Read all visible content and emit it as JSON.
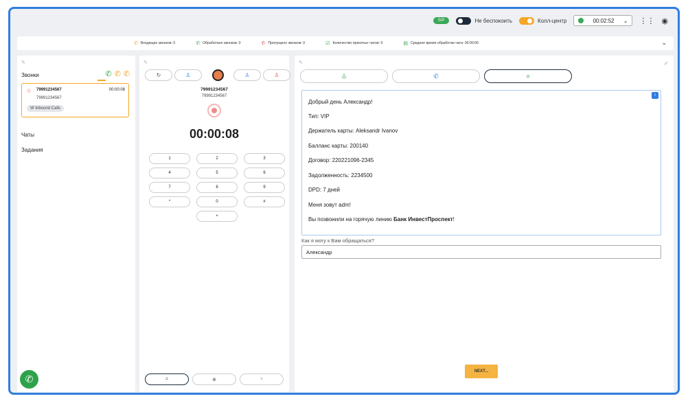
{
  "topbar": {
    "sip": "SIP",
    "dnd_label": "Не беспокоить",
    "callcenter_label": "Колл-центр",
    "timer": "00:02:52"
  },
  "stats": [
    {
      "icon": "incoming-call-icon",
      "label": "Входящих звонков: 0"
    },
    {
      "icon": "processed-call-icon",
      "label": "Обработано звонков: 0"
    },
    {
      "icon": "missed-call-icon",
      "label": "Пропущено звонков: 0"
    },
    {
      "icon": "chat-accepted-icon",
      "label": "Количество принятых чатов: 0"
    },
    {
      "icon": "chat-time-icon",
      "label": "Среднее время обработки чата: 00:00:00"
    }
  ],
  "left": {
    "section_title": "Звонки",
    "call": {
      "number": "79991234567",
      "time": "00:00:08",
      "number2": "79991234567",
      "tag": "W Inbound Calls"
    },
    "nav": [
      "Чаты",
      "Задания"
    ]
  },
  "dialer": {
    "number1": "79991234567",
    "number2": "79991234567",
    "timer": "00:00:08",
    "keys": [
      "1",
      "2",
      "3",
      "4",
      "5",
      "6",
      "7",
      "8",
      "9",
      "*",
      "0",
      "#",
      "+"
    ]
  },
  "script": {
    "lines": [
      "Добрый день Александр!",
      "Тип: VIP",
      "Держатель карты: Aleksandr Ivanov",
      "Балланс карты: 200140",
      "Договор: 220221096-2345",
      "Задолженность: 2234500",
      "DPD: 7 дней",
      "Меня зовут adm!"
    ],
    "last_prefix": "Вы позвонили на горячую линию ",
    "last_bold": "Банк ИнвестПроспект",
    "last_suffix": "!",
    "question": "Как я могу к Вам обращаться?",
    "answer": "Александр",
    "next": "NEXT..."
  },
  "colors": {
    "accent": "#2f7de1",
    "green": "#3aa856",
    "orange": "#f5a623"
  }
}
